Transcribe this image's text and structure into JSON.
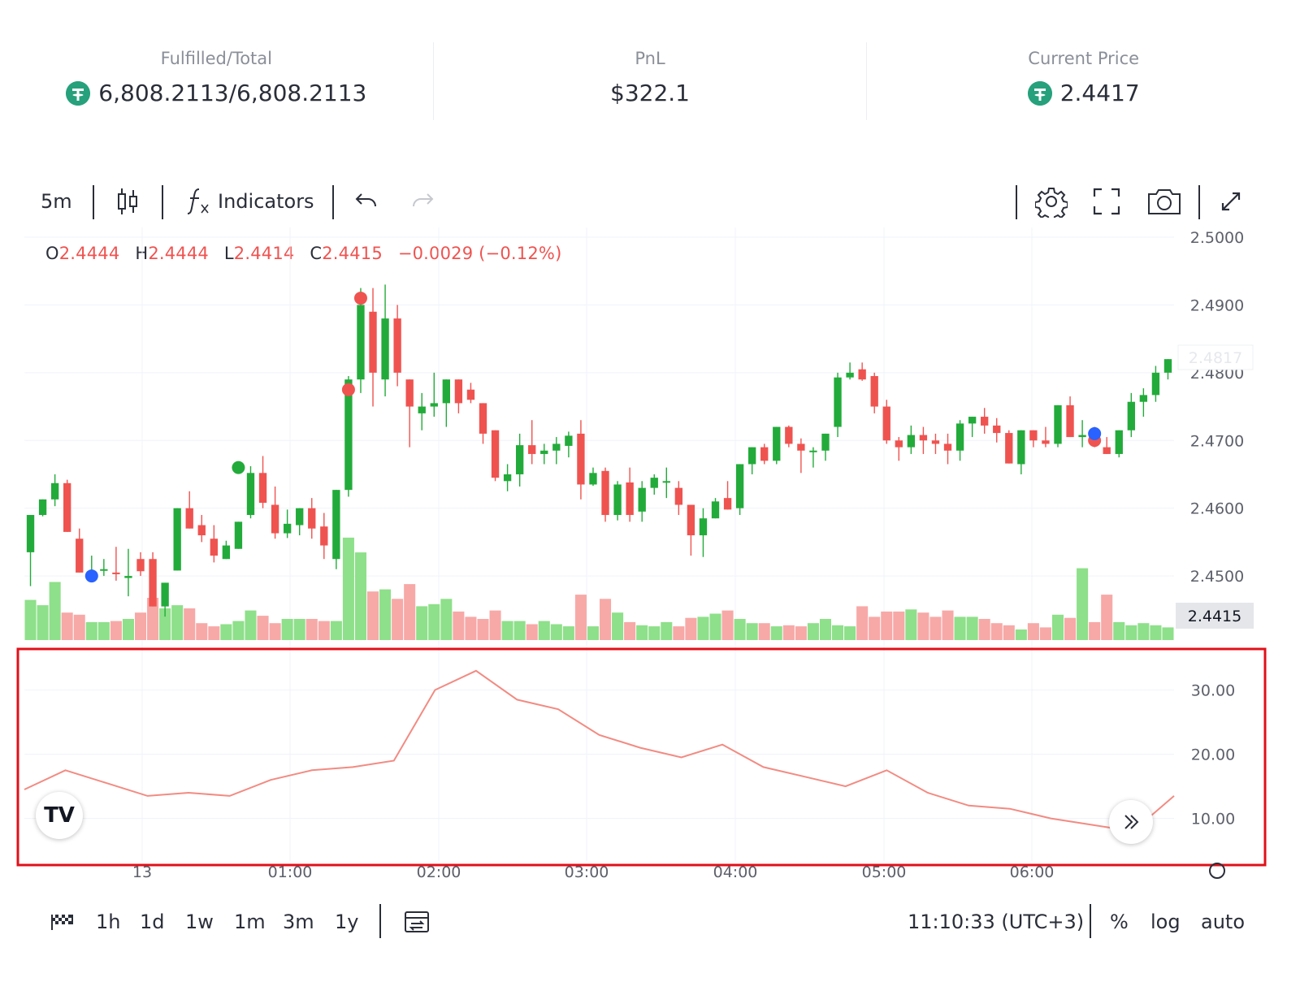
{
  "stats": [
    {
      "label": "Fulfilled/Total",
      "value": "6,808.2113/6,808.2113",
      "icon": "tether-coin-icon"
    },
    {
      "label": "PnL",
      "value": "$322.1"
    },
    {
      "label": "Current Price",
      "value": "2.4417",
      "icon": "tether-coin-icon"
    }
  ],
  "toolbar": {
    "interval": "5m",
    "indicators_label": "Indicators"
  },
  "ohlc": {
    "o_key": "O",
    "o_val": "2.4444",
    "h_key": "H",
    "h_val": "2.4444",
    "l_key": "L",
    "l_val": "2.4414",
    "c_key": "C",
    "c_val": "2.4415",
    "change": "−0.0029 (−0.12%)"
  },
  "logo_text": "TV",
  "bottom": {
    "ranges": [
      "1h",
      "1d",
      "1w",
      "1m",
      "3m",
      "1y"
    ],
    "clock": "11:10:33 (UTC+3)",
    "percent": "%",
    "log": "log",
    "auto": "auto"
  },
  "colors": {
    "up": "#22ab3a",
    "down": "#ef5350",
    "vol_up": "#8ee08a",
    "vol_down": "#f7a9a7",
    "indicator": "#f28b82",
    "highlight": "#e0101a"
  },
  "chart_data": {
    "type": "candlestick",
    "price_axis": {
      "ticks": [
        "2.5000",
        "2.4900",
        "2.4800",
        "2.4700",
        "2.4600",
        "2.4500"
      ],
      "ylim": [
        2.4415,
        2.5
      ]
    },
    "current_price_label": "2.4817",
    "last_price_label": "2.4415",
    "indicator_axis": {
      "ticks": [
        "30.00",
        "20.00",
        "10.00"
      ],
      "ylim": [
        4.0,
        35.0
      ]
    },
    "time_labels": [
      "13",
      "01:00",
      "02:00",
      "03:00",
      "04:00",
      "05:00",
      "06:00"
    ],
    "candles": [
      [
        2.4535,
        2.459,
        2.4485,
        2.459
      ],
      [
        2.459,
        2.4613,
        2.4588,
        2.4613
      ],
      [
        2.4613,
        2.465,
        2.4603,
        2.4637
      ],
      [
        2.4637,
        2.4642,
        2.4565,
        2.4565
      ],
      [
        2.4555,
        2.457,
        2.4505,
        2.4505
      ],
      [
        2.4505,
        2.453,
        2.4495,
        2.4505
      ],
      [
        2.451,
        2.4525,
        2.45,
        2.451
      ],
      [
        2.4505,
        2.4543,
        2.4493,
        2.4503
      ],
      [
        2.4497,
        2.454,
        2.447,
        2.45
      ],
      [
        2.4525,
        2.4535,
        2.45,
        2.4507
      ],
      [
        2.4525,
        2.4535,
        2.447,
        2.4455
      ],
      [
        2.4455,
        2.448,
        2.444,
        2.449
      ],
      [
        2.4508,
        2.46,
        2.4508,
        2.46
      ],
      [
        2.46,
        2.4625,
        2.457,
        2.457
      ],
      [
        2.4575,
        2.459,
        2.455,
        2.456
      ],
      [
        2.4555,
        2.4575,
        2.452,
        2.453
      ],
      [
        2.4525,
        2.4552,
        2.4528,
        2.4545
      ],
      [
        2.454,
        2.458,
        2.4545,
        2.458
      ],
      [
        2.459,
        2.4662,
        2.4585,
        2.4652
      ],
      [
        2.4652,
        2.4677,
        2.46,
        2.4608
      ],
      [
        2.4605,
        2.4632,
        2.4555,
        2.4563
      ],
      [
        2.4563,
        2.4598,
        2.4556,
        2.4577
      ],
      [
        2.4575,
        2.4597,
        2.456,
        2.46
      ],
      [
        2.46,
        2.4615,
        2.4555,
        2.457
      ],
      [
        2.4573,
        2.4593,
        2.4525,
        2.4545
      ],
      [
        2.4525,
        2.4627,
        2.451,
        2.4627
      ],
      [
        2.4627,
        2.4795,
        2.4617,
        2.479
      ],
      [
        2.479,
        2.4925,
        2.477,
        2.49
      ],
      [
        2.489,
        2.4925,
        2.475,
        2.48
      ],
      [
        2.479,
        2.493,
        2.4765,
        2.488
      ],
      [
        2.488,
        2.49,
        2.478,
        2.48
      ],
      [
        2.479,
        2.475,
        2.469,
        2.475
      ],
      [
        2.474,
        2.477,
        2.4715,
        2.475
      ],
      [
        2.475,
        2.48,
        2.4735,
        2.4755
      ],
      [
        2.4755,
        2.479,
        2.472,
        2.479
      ],
      [
        2.479,
        2.478,
        2.474,
        2.4755
      ],
      [
        2.4775,
        2.4785,
        2.4755,
        2.476
      ],
      [
        2.4755,
        2.474,
        2.4695,
        2.471
      ],
      [
        2.4715,
        2.4715,
        2.464,
        2.4645
      ],
      [
        2.464,
        2.4665,
        2.4625,
        2.465
      ],
      [
        2.465,
        2.471,
        2.4632,
        2.4693
      ],
      [
        2.4693,
        2.473,
        2.4665,
        2.468
      ],
      [
        2.468,
        2.4695,
        2.4665,
        2.4685
      ],
      [
        2.4685,
        2.4705,
        2.4665,
        2.4695
      ],
      [
        2.4692,
        2.4713,
        2.4675,
        2.4707
      ],
      [
        2.471,
        2.473,
        2.4613,
        2.4635
      ],
      [
        2.4635,
        2.466,
        2.4633,
        2.4652
      ],
      [
        2.4655,
        2.466,
        2.458,
        2.459
      ],
      [
        2.459,
        2.464,
        2.4582,
        2.4635
      ],
      [
        2.4638,
        2.466,
        2.458,
        2.459
      ],
      [
        2.4595,
        2.464,
        2.458,
        2.463
      ],
      [
        2.463,
        2.465,
        2.462,
        2.4645
      ],
      [
        2.464,
        2.466,
        2.4615,
        2.464
      ],
      [
        2.463,
        2.464,
        2.459,
        2.4605
      ],
      [
        2.4605,
        2.4605,
        2.453,
        2.456
      ],
      [
        2.456,
        2.46,
        2.4528,
        2.4585
      ],
      [
        2.4585,
        2.4615,
        2.4585,
        2.461
      ],
      [
        2.4615,
        2.464,
        2.4598,
        2.4598
      ],
      [
        2.46,
        2.466,
        2.459,
        2.4665
      ],
      [
        2.4665,
        2.4688,
        2.465,
        2.469
      ],
      [
        2.469,
        2.4695,
        2.4665,
        2.467
      ],
      [
        2.467,
        2.472,
        2.4665,
        2.472
      ],
      [
        2.472,
        2.4722,
        2.469,
        2.4695
      ],
      [
        2.4695,
        2.4703,
        2.4652,
        2.4685
      ],
      [
        2.4685,
        2.469,
        2.466,
        2.4685
      ],
      [
        2.4685,
        2.471,
        2.467,
        2.471
      ],
      [
        2.472,
        2.48,
        2.4705,
        2.4793
      ],
      [
        2.4793,
        2.4815,
        2.479,
        2.48
      ],
      [
        2.4805,
        2.4815,
        2.4788,
        2.479
      ],
      [
        2.4795,
        2.48,
        2.474,
        2.475
      ],
      [
        2.475,
        2.476,
        2.4695,
        2.47
      ],
      [
        2.47,
        2.4705,
        2.467,
        2.469
      ],
      [
        2.469,
        2.4722,
        2.468,
        2.4708
      ],
      [
        2.4708,
        2.472,
        2.468,
        2.47
      ],
      [
        2.47,
        2.471,
        2.468,
        2.4695
      ],
      [
        2.4695,
        2.471,
        2.4665,
        2.4685
      ],
      [
        2.4685,
        2.473,
        2.467,
        2.4725
      ],
      [
        2.4725,
        2.4735,
        2.4705,
        2.4735
      ],
      [
        2.4735,
        2.4748,
        2.471,
        2.4722
      ],
      [
        2.4722,
        2.4733,
        2.4697,
        2.4711
      ],
      [
        2.4711,
        2.4715,
        2.467,
        2.4666
      ],
      [
        2.4665,
        2.471,
        2.465,
        2.4715
      ],
      [
        2.4715,
        2.471,
        2.469,
        2.47
      ],
      [
        2.47,
        2.472,
        2.469,
        2.4695
      ],
      [
        2.4695,
        2.4752,
        2.469,
        2.4752
      ],
      [
        2.4752,
        2.4765,
        2.4705,
        2.4705
      ],
      [
        2.4705,
        2.473,
        2.469,
        2.4708
      ],
      [
        2.4708,
        2.472,
        2.469,
        2.47
      ],
      [
        2.469,
        2.4705,
        2.468,
        2.468
      ],
      [
        2.468,
        2.4715,
        2.4675,
        2.4715
      ],
      [
        2.4715,
        2.477,
        2.4705,
        2.4757
      ],
      [
        2.4757,
        2.4777,
        2.4735,
        2.4767
      ],
      [
        2.4767,
        2.481,
        2.4757,
        2.48
      ],
      [
        2.48,
        2.482,
        2.479,
        2.482
      ]
    ],
    "volumes": [
      0.38,
      0.33,
      0.55,
      0.26,
      0.24,
      0.17,
      0.17,
      0.18,
      0.2,
      0.26,
      0.4,
      0.3,
      0.33,
      0.3,
      0.16,
      0.13,
      0.15,
      0.18,
      0.28,
      0.23,
      0.16,
      0.2,
      0.2,
      0.2,
      0.18,
      0.18,
      0.97,
      0.83,
      0.46,
      0.48,
      0.39,
      0.53,
      0.32,
      0.34,
      0.39,
      0.27,
      0.22,
      0.2,
      0.28,
      0.18,
      0.18,
      0.15,
      0.18,
      0.15,
      0.13,
      0.43,
      0.13,
      0.39,
      0.26,
      0.17,
      0.14,
      0.13,
      0.17,
      0.13,
      0.21,
      0.22,
      0.25,
      0.28,
      0.2,
      0.16,
      0.16,
      0.13,
      0.14,
      0.13,
      0.16,
      0.2,
      0.14,
      0.13,
      0.32,
      0.22,
      0.27,
      0.27,
      0.29,
      0.26,
      0.22,
      0.28,
      0.22,
      0.22,
      0.2,
      0.16,
      0.14,
      0.1,
      0.16,
      0.12,
      0.24,
      0.21,
      0.68,
      0.17,
      0.43,
      0.17,
      0.14,
      0.16,
      0.14,
      0.12,
      0.12,
      0.2,
      0.63,
      0.29,
      0.15
    ],
    "indicator": [
      14.5,
      17.5,
      15.5,
      13.5,
      14.0,
      13.5,
      16.0,
      17.5,
      18.0,
      19.0,
      30.0,
      33.0,
      28.5,
      27.0,
      23.0,
      21.0,
      19.5,
      21.5,
      18.0,
      16.5,
      15.0,
      17.5,
      14.0,
      12.0,
      11.5,
      10.0,
      9.0,
      8.0,
      13.5
    ],
    "markers": [
      {
        "x_index": 5,
        "price": 2.45,
        "color": "blue"
      },
      {
        "x_index": 17,
        "price": 2.466,
        "color": "green"
      },
      {
        "x_index": 26,
        "price": 2.4775,
        "color": "red"
      },
      {
        "x_index": 27,
        "price": 2.491,
        "color": "red"
      },
      {
        "x_index": 87,
        "price": 2.47,
        "color": "red"
      },
      {
        "x_index": 87,
        "price": 2.471,
        "color": "blue"
      }
    ]
  }
}
